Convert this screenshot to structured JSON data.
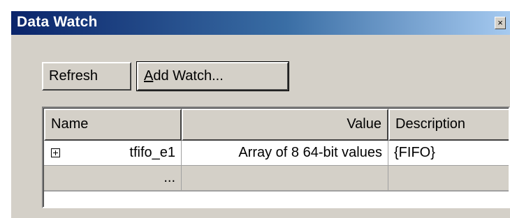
{
  "window": {
    "title": "Data Watch",
    "close_glyph": "×"
  },
  "toolbar": {
    "refresh_label": "Refresh",
    "add_watch_accel": "A",
    "add_watch_rest": "dd Watch..."
  },
  "grid": {
    "columns": [
      "Name",
      "Value",
      "Description"
    ],
    "rows": [
      {
        "expand_icon": "plus-box-icon",
        "name": "tfifo_e1",
        "value": "Array of 8 64-bit values",
        "description": "{FIFO}"
      },
      {
        "name": "...",
        "value": "",
        "description": ""
      }
    ]
  },
  "colors": {
    "face": "#d4d0c8",
    "title_gradient_start": "#0a246a",
    "title_gradient_end": "#a6caf0"
  }
}
